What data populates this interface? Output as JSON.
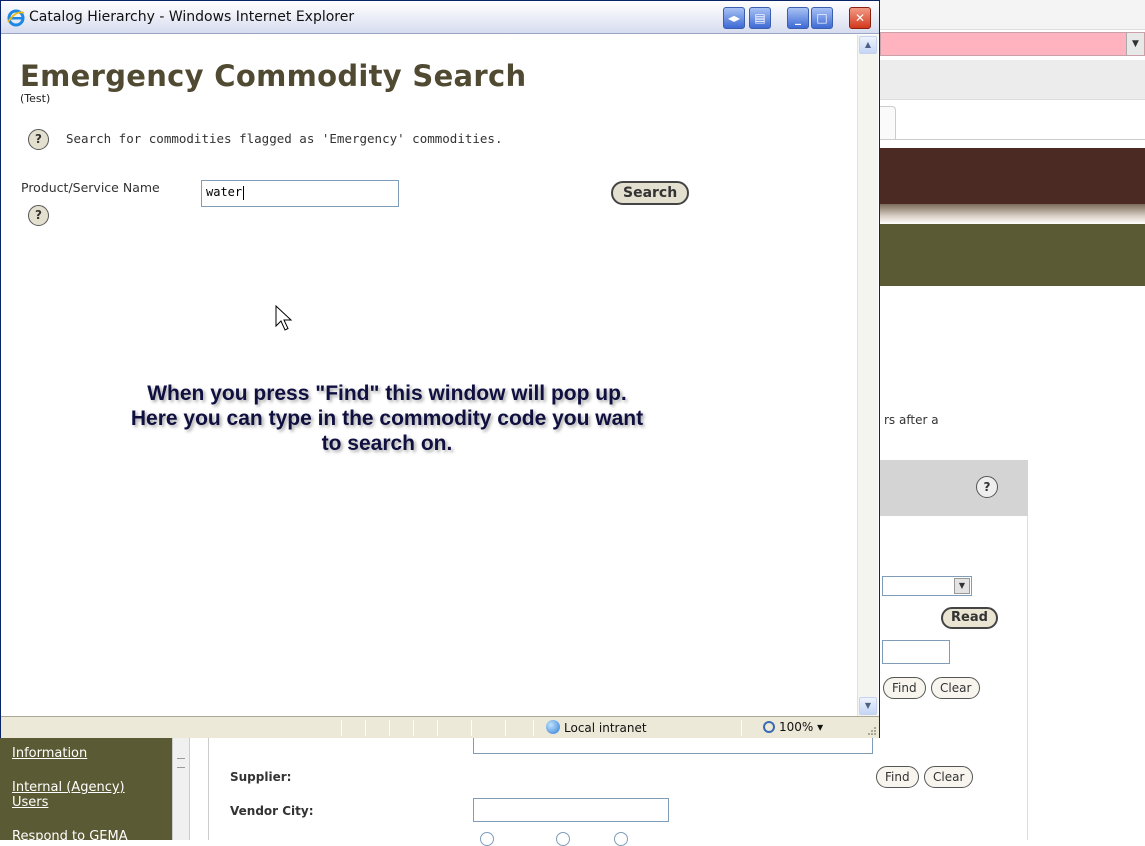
{
  "window": {
    "title": "Catalog Hierarchy - Windows Internet Explorer",
    "buttons": {
      "minimize": "_",
      "maximize": "□",
      "close": "✕"
    }
  },
  "page": {
    "title": "Emergency Commodity Search",
    "subtitle": "(Test)",
    "description": "Search for commodities flagged as 'Emergency' commodities.",
    "help_icon": "?",
    "field_label": "Product/Service Name",
    "field_value": "water",
    "search_button": "Search"
  },
  "callout": {
    "lines": [
      "When you press \"Find\" this window will pop up.",
      "Here you can type in the commodity code you want",
      "to search on."
    ]
  },
  "statusbar": {
    "zone": "Local intranet",
    "zoom": "100%"
  },
  "background": {
    "truncated_text": "rs after a",
    "help_icon": "?",
    "read_button": "Read",
    "find_button": "Find",
    "clear_button": "Clear",
    "supplier_label": "Supplier:",
    "vendor_city_label": "Vendor City:",
    "sidebar": [
      "Information",
      "Internal (Agency)",
      "Users",
      "Respond to GEMA"
    ]
  },
  "colors": {
    "title_olive": "#504a32",
    "brown_band": "#4a2a22",
    "olive_band": "#5a5a34",
    "pink_select": "#ffb3bf",
    "callout_text": "#101040"
  }
}
